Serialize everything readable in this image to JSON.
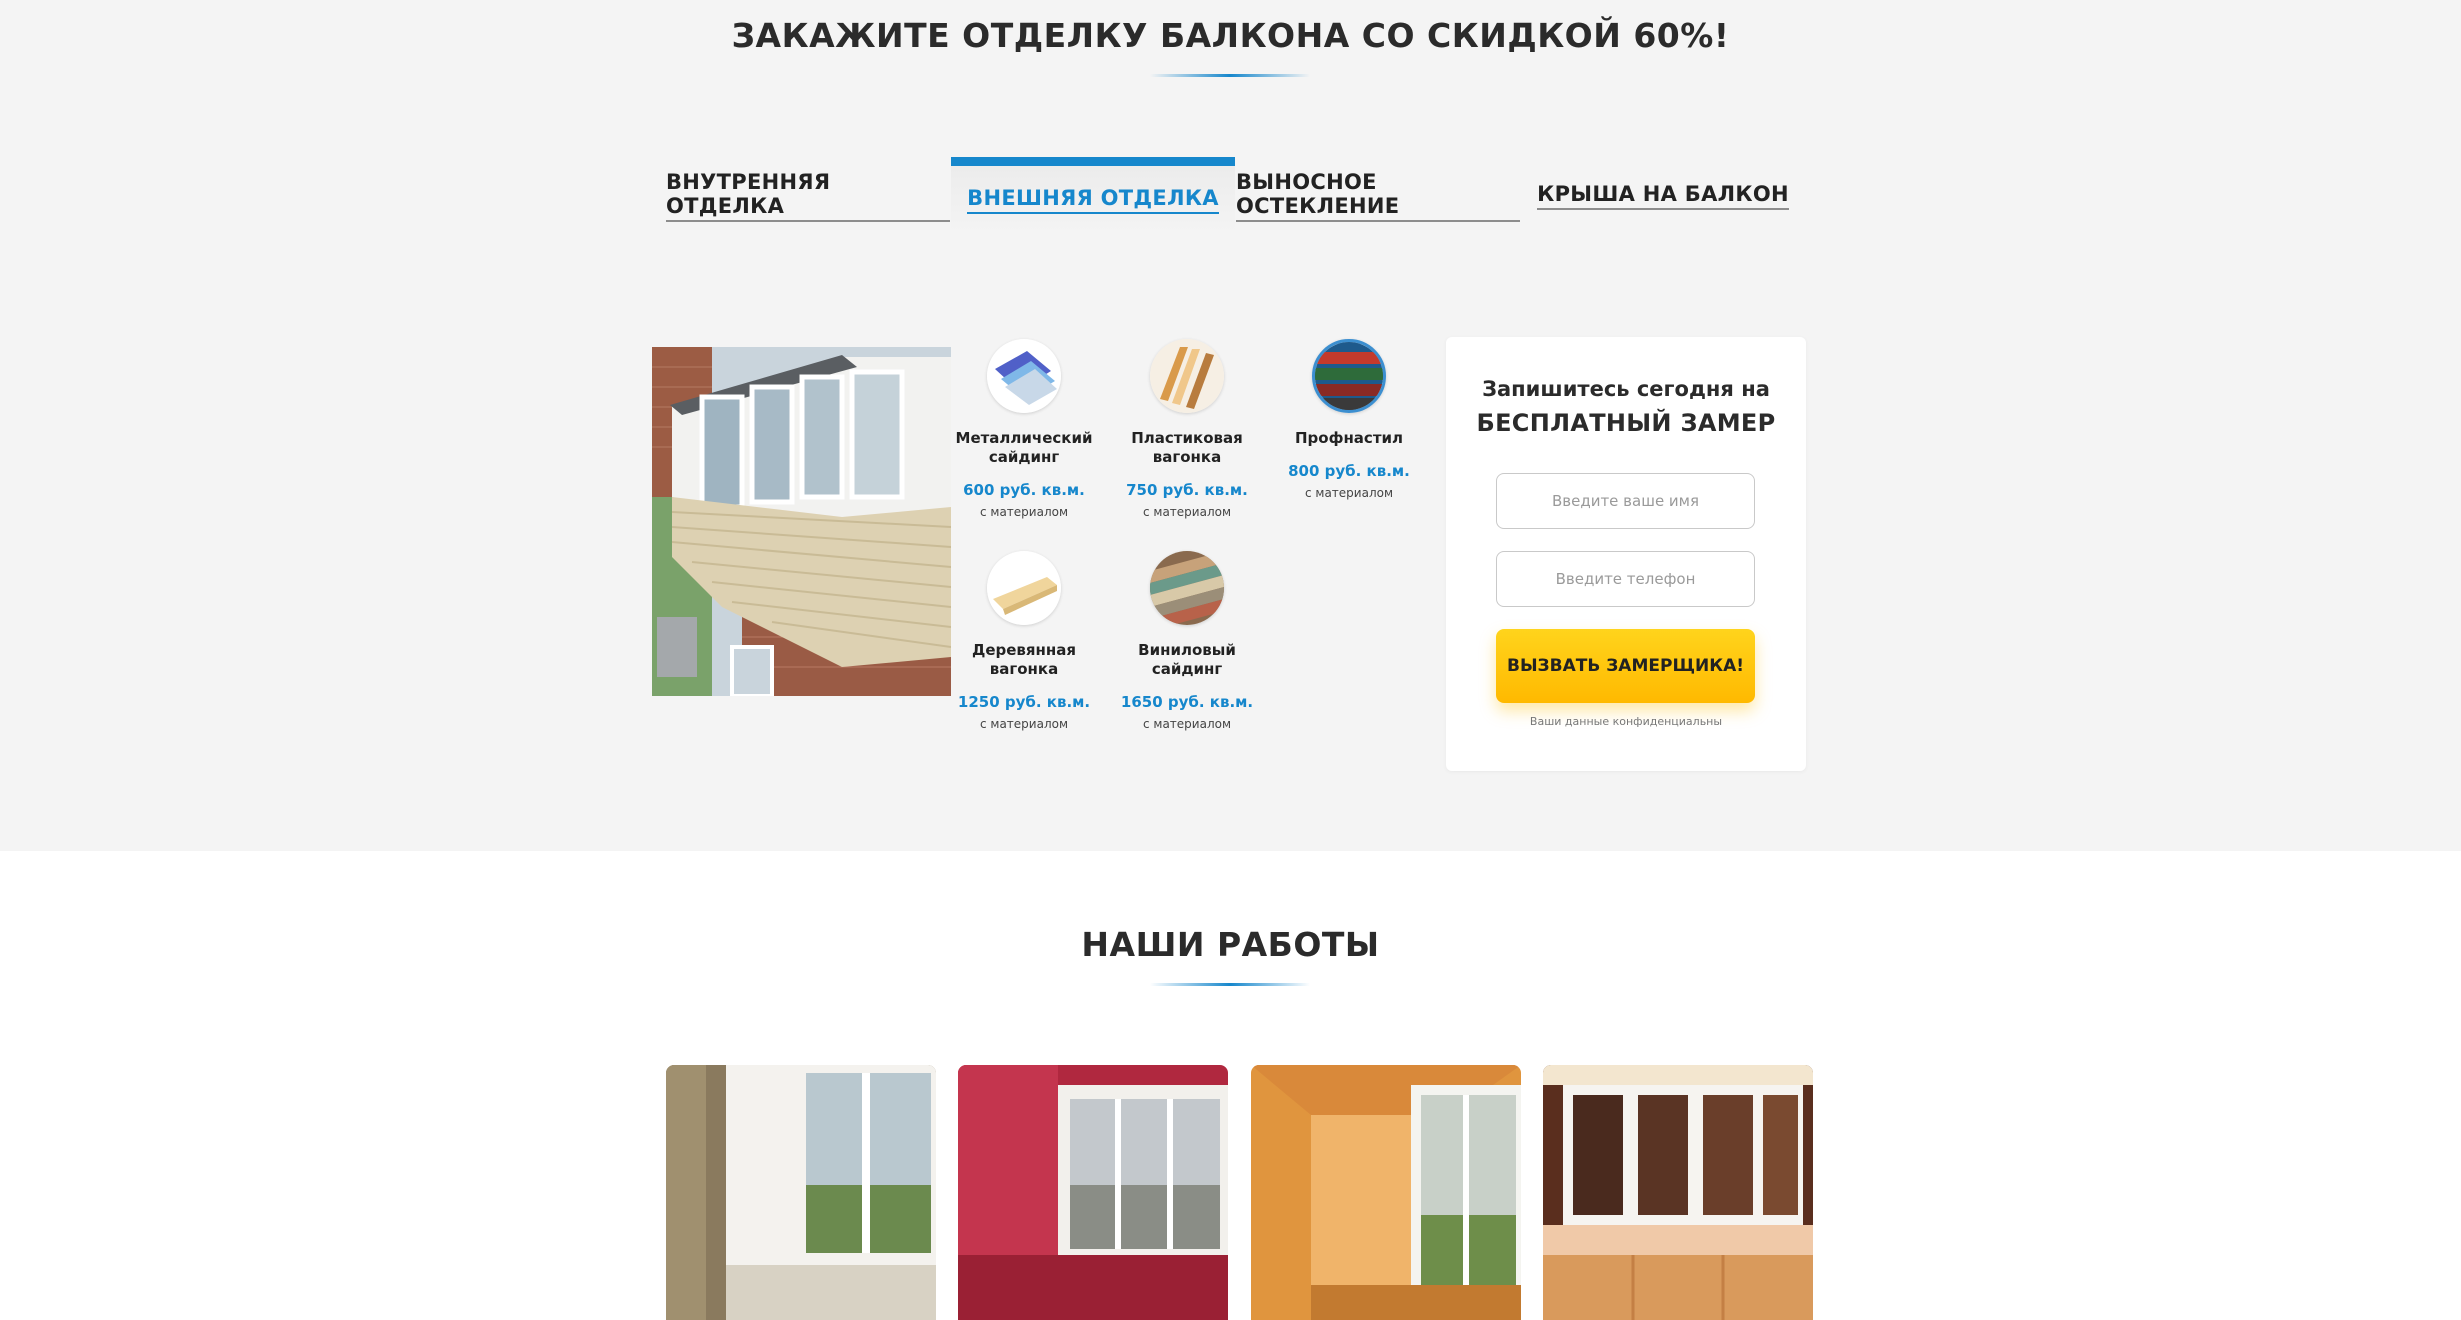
{
  "offer": {
    "title": "ЗАКАЖИТЕ ОТДЕЛКУ БАЛКОНА СО СКИДКОЙ 60%!"
  },
  "tabs": [
    {
      "label": "ВНУТРЕННЯЯ ОТДЕЛКА",
      "active": false
    },
    {
      "label": "ВНЕШНЯЯ ОТДЕЛКА",
      "active": true
    },
    {
      "label": "ВЫНОСНОЕ ОСТЕКЛЕНИЕ",
      "active": false
    },
    {
      "label": "КРЫША НА БАЛКОН",
      "active": false
    }
  ],
  "products": [
    {
      "name_line1": "Металлический",
      "name_line2": "сайдинг",
      "price": "600 руб. кв.м.",
      "note": "с материалом",
      "icon": "metal-siding-icon"
    },
    {
      "name_line1": "Пластиковая",
      "name_line2": "вагонка",
      "price": "750 руб. кв.м.",
      "note": "с материалом",
      "icon": "plastic-lining-icon"
    },
    {
      "name_line1": "Профнастил",
      "name_line2": "",
      "price": "800 руб. кв.м.",
      "note": "с материалом",
      "icon": "corrugated-sheet-icon"
    },
    {
      "name_line1": "Деревянная",
      "name_line2": "вагонка",
      "price": "1250 руб. кв.м.",
      "note": "с материалом",
      "icon": "wood-lining-icon"
    },
    {
      "name_line1": "Виниловый",
      "name_line2": "сайдинг",
      "price": "1650 руб. кв.м.",
      "note": "с материалом",
      "icon": "vinyl-siding-icon"
    }
  ],
  "form": {
    "heading_line1": "Запишитесь сегодня на",
    "heading_line2": "БЕСПЛАТНЫЙ ЗАМЕР",
    "name_placeholder": "Введите ваше имя",
    "phone_placeholder": "Введите телефон",
    "submit_label": "ВЫЗВАТЬ ЗАМЕРЩИКА!",
    "privacy_note": "Ваши данные конфиденциальны"
  },
  "works": {
    "title": "НАШИ РАБОТЫ"
  },
  "colors": {
    "accent": "#1687cc",
    "button": "#ffc107",
    "section_bg": "#f4f4f4"
  }
}
